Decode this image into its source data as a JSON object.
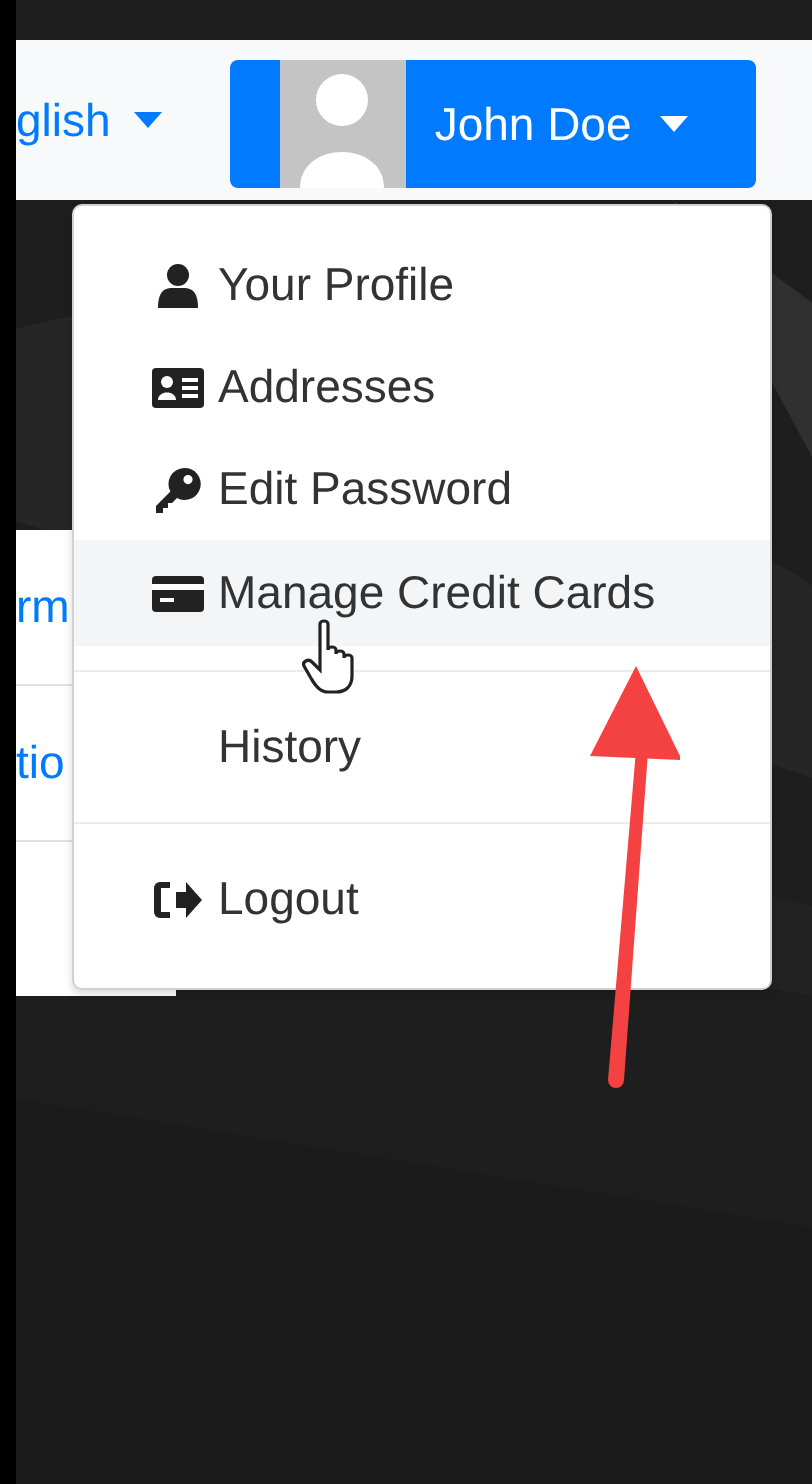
{
  "language_menu": {
    "label": "glish"
  },
  "user_menu": {
    "name": "John Doe",
    "expanded": true
  },
  "side_panel": {
    "rows": [
      {
        "text": "rm"
      },
      {
        "text": "tio"
      }
    ]
  },
  "dropdown": {
    "items": [
      {
        "kind": "link",
        "label": "Your Profile",
        "hovered": false
      },
      {
        "kind": "link",
        "label": "Addresses",
        "hovered": false
      },
      {
        "kind": "link",
        "label": "Edit Password",
        "hovered": false
      },
      {
        "kind": "link",
        "label": "Manage Credit Cards",
        "hovered": true
      },
      {
        "kind": "divider"
      },
      {
        "kind": "link",
        "label": "History",
        "hovered": false
      },
      {
        "kind": "divider"
      },
      {
        "kind": "link",
        "label": "Logout",
        "hovered": false
      }
    ]
  }
}
